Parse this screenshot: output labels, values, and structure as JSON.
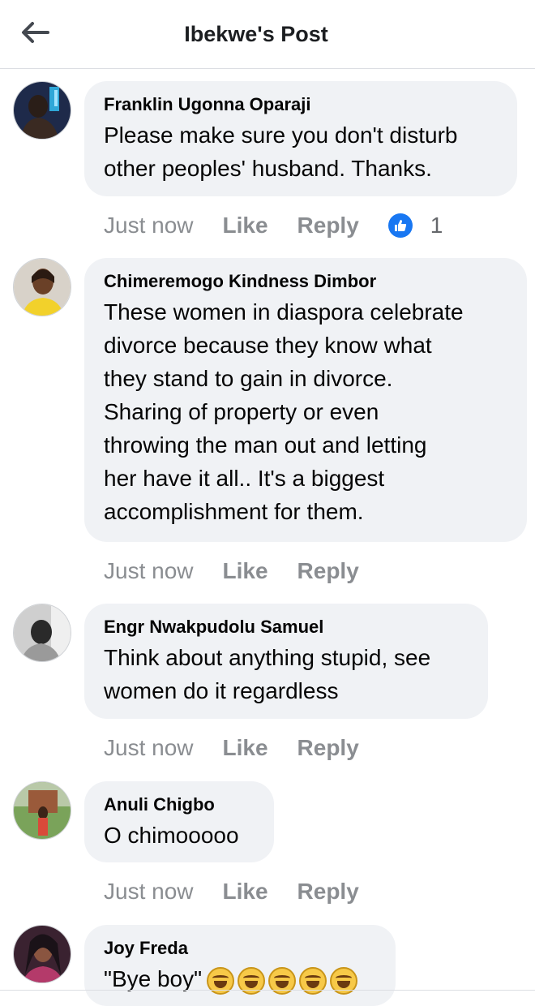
{
  "header": {
    "title": "Ibekwe's Post",
    "back_icon": "arrow-left-icon"
  },
  "colors": {
    "bubble": "#f0f2f5",
    "meta": "#8a8d91",
    "like_badge": "#1877f2"
  },
  "comments": [
    {
      "author": "Franklin Ugonna Oparaji",
      "text": "Please make sure you don't disturb\nother peoples' husband. Thanks.",
      "time": "Just now",
      "like_label": "Like",
      "reply_label": "Reply",
      "reaction_count": "1"
    },
    {
      "author": "Chimeremogo Kindness Dimbor",
      "text": "These women in diaspora celebrate\ndivorce because they know what\nthey stand to gain in divorce.\nSharing of property or even\nthrowing the man out and letting\nher have it all.. It's a biggest\naccomplishment for them.",
      "time": "Just now",
      "like_label": "Like",
      "reply_label": "Reply"
    },
    {
      "author": "Engr Nwakpudolu Samuel",
      "text": "Think about anything stupid, see\nwomen do it regardless",
      "time": "Just now",
      "like_label": "Like",
      "reply_label": "Reply"
    },
    {
      "author": "Anuli Chigbo",
      "text": "O chimooooo",
      "time": "Just now",
      "like_label": "Like",
      "reply_label": "Reply"
    },
    {
      "author": "Joy Freda",
      "text": "\"Bye boy\"",
      "emoji_count": 5,
      "emoji_name": "rolling-on-the-floor-laughing-emoji"
    }
  ]
}
